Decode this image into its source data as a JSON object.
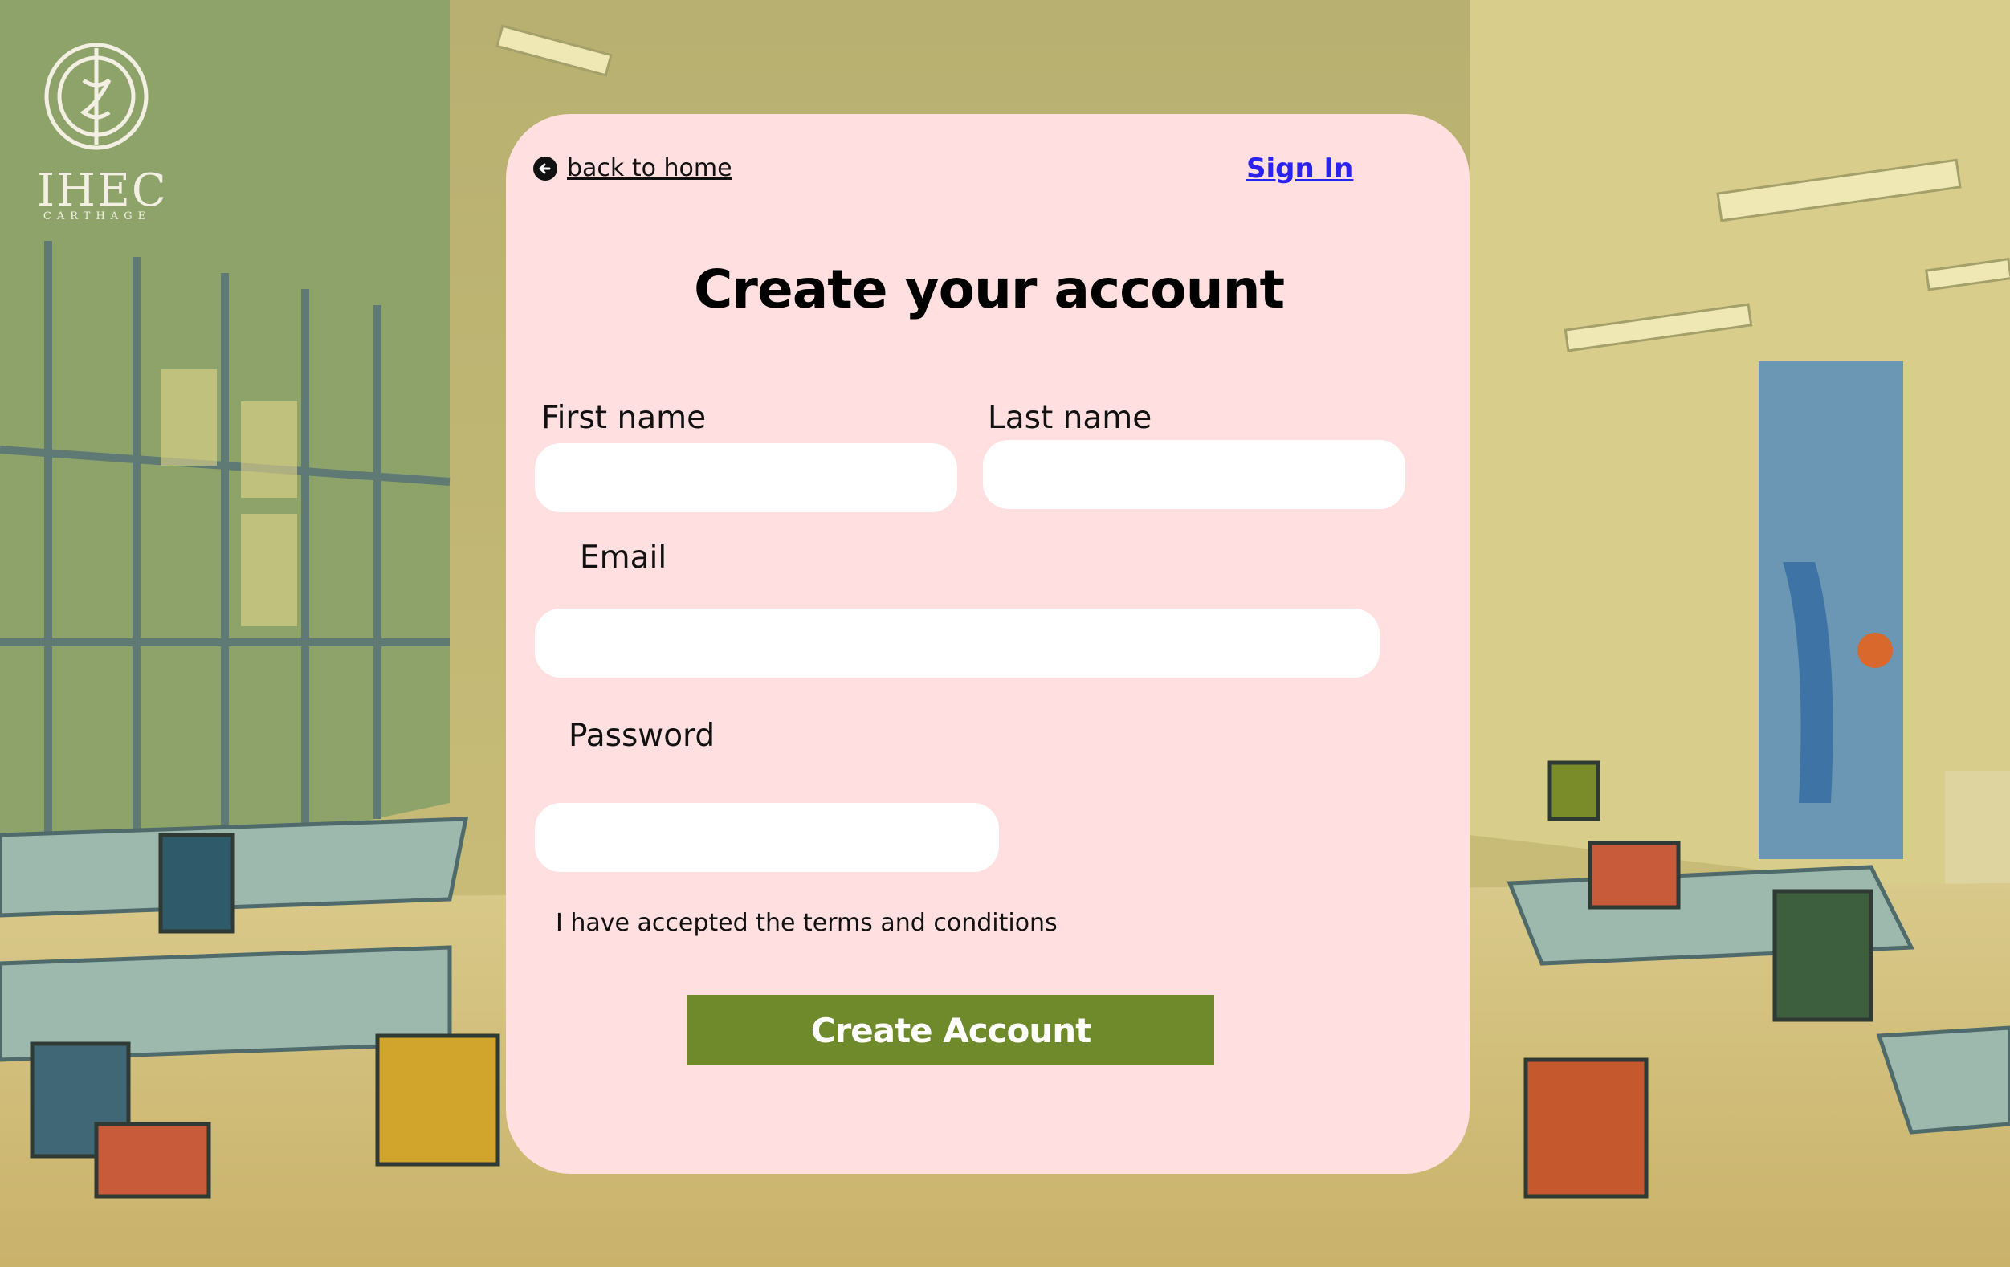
{
  "brand": {
    "logo_text": "IHEC",
    "logo_subtext": "CARTHAGE"
  },
  "nav": {
    "back_label": "back to home",
    "back_icon": "arrow-left-circle-icon",
    "signin_label": "Sign In"
  },
  "form": {
    "title": "Create your account",
    "first_name": {
      "label": "First name",
      "value": "",
      "placeholder": ""
    },
    "last_name": {
      "label": "Last name",
      "value": "",
      "placeholder": ""
    },
    "email": {
      "label": "Email",
      "value": "",
      "placeholder": ""
    },
    "password": {
      "label": "Password",
      "value": "",
      "placeholder": ""
    },
    "terms_text": "I have accepted the terms and conditions",
    "submit_label": "Create Account"
  },
  "colors": {
    "card": "#ffdfe0",
    "submit": "#6e8a2a",
    "signin_link": "#2b22ee"
  }
}
